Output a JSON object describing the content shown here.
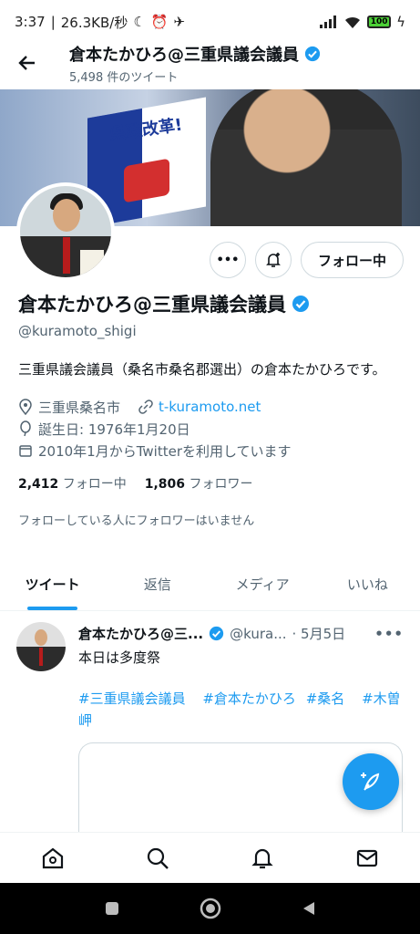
{
  "status_bar": {
    "time": "3:37",
    "speed": "26.3KB/秒",
    "battery": "100"
  },
  "header": {
    "back_icon": "back-arrow-icon",
    "title": "倉本たかひろ@三重県議会議員",
    "tweet_count": "5,498 件のツイート"
  },
  "banner": {
    "flag_text": "県政改革!"
  },
  "actions": {
    "more_label": "•••",
    "follow_label": "フォロー中"
  },
  "profile": {
    "name": "倉本たかひろ@三重県議会議員",
    "handle": "@kuramoto_shigi",
    "bio": "三重県議会議員（桑名市桑名郡選出）の倉本たかひろです。",
    "location": "三重県桑名市",
    "website": "t-kuramoto.net",
    "birthday": "誕生日: 1976年1月20日",
    "joined": "2010年1月からTwitterを利用しています",
    "following_count": "2,412",
    "following_label": "フォロー中",
    "followers_count": "1,806",
    "followers_label": "フォロワー",
    "no_mutual": "フォローしている人にフォロワーはいません"
  },
  "tabs": [
    {
      "label": "ツイート",
      "active": true
    },
    {
      "label": "返信",
      "active": false
    },
    {
      "label": "メディア",
      "active": false
    },
    {
      "label": "いいね",
      "active": false
    }
  ],
  "tweet": {
    "name": "倉本たかひろ@三...",
    "handle": "@kura...",
    "date": "· 5月5日",
    "more": "•••",
    "text": "本日は多度祭",
    "hashtags": [
      "#三重県議会議員",
      "#倉本たかひろ",
      "#桑名",
      "#木曽岬"
    ]
  },
  "bottom_nav": [
    "home-icon",
    "search-icon",
    "notifications-icon",
    "messages-icon"
  ],
  "colors": {
    "accent": "#1d9bf0",
    "text": "#0f1419",
    "secondary": "#536471"
  }
}
